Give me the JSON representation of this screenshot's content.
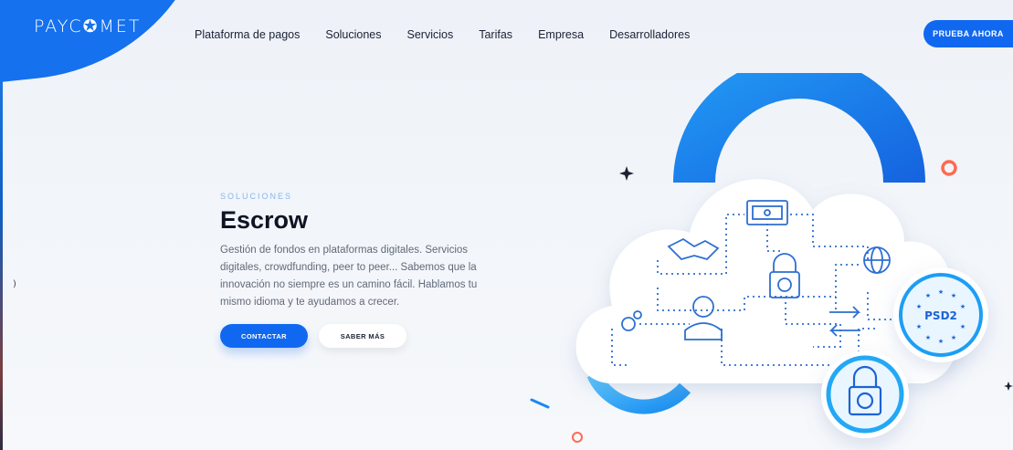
{
  "brand": {
    "logo_text": "PAYC✪MET",
    "accent": "#1168f0"
  },
  "nav": {
    "items": [
      "Plataforma de pagos",
      "Soluciones",
      "Servicios",
      "Tarifas",
      "Empresa",
      "Desarrolladores"
    ],
    "cta_label": "PRUEBA AHORA"
  },
  "hero": {
    "eyebrow": "SOLUCIONES",
    "title": "Escrow",
    "description": "Gestión de fondos en plataformas digitales. Servicios digitales, crowdfunding, peer to peer... Sabemos que la innovación no siempre es un camino fácil. Hablamos tu mismo idioma y te ayudamos a crecer.",
    "primary_button": "CONTACTAR",
    "secondary_button": "SABER MÁS"
  },
  "illustration": {
    "badge_psd2": "PSD2",
    "icons": [
      "money-icon",
      "handshake-icon",
      "globe-icon",
      "lock-euro-icon",
      "user-icon",
      "gears-icon",
      "arrows-icon"
    ]
  }
}
